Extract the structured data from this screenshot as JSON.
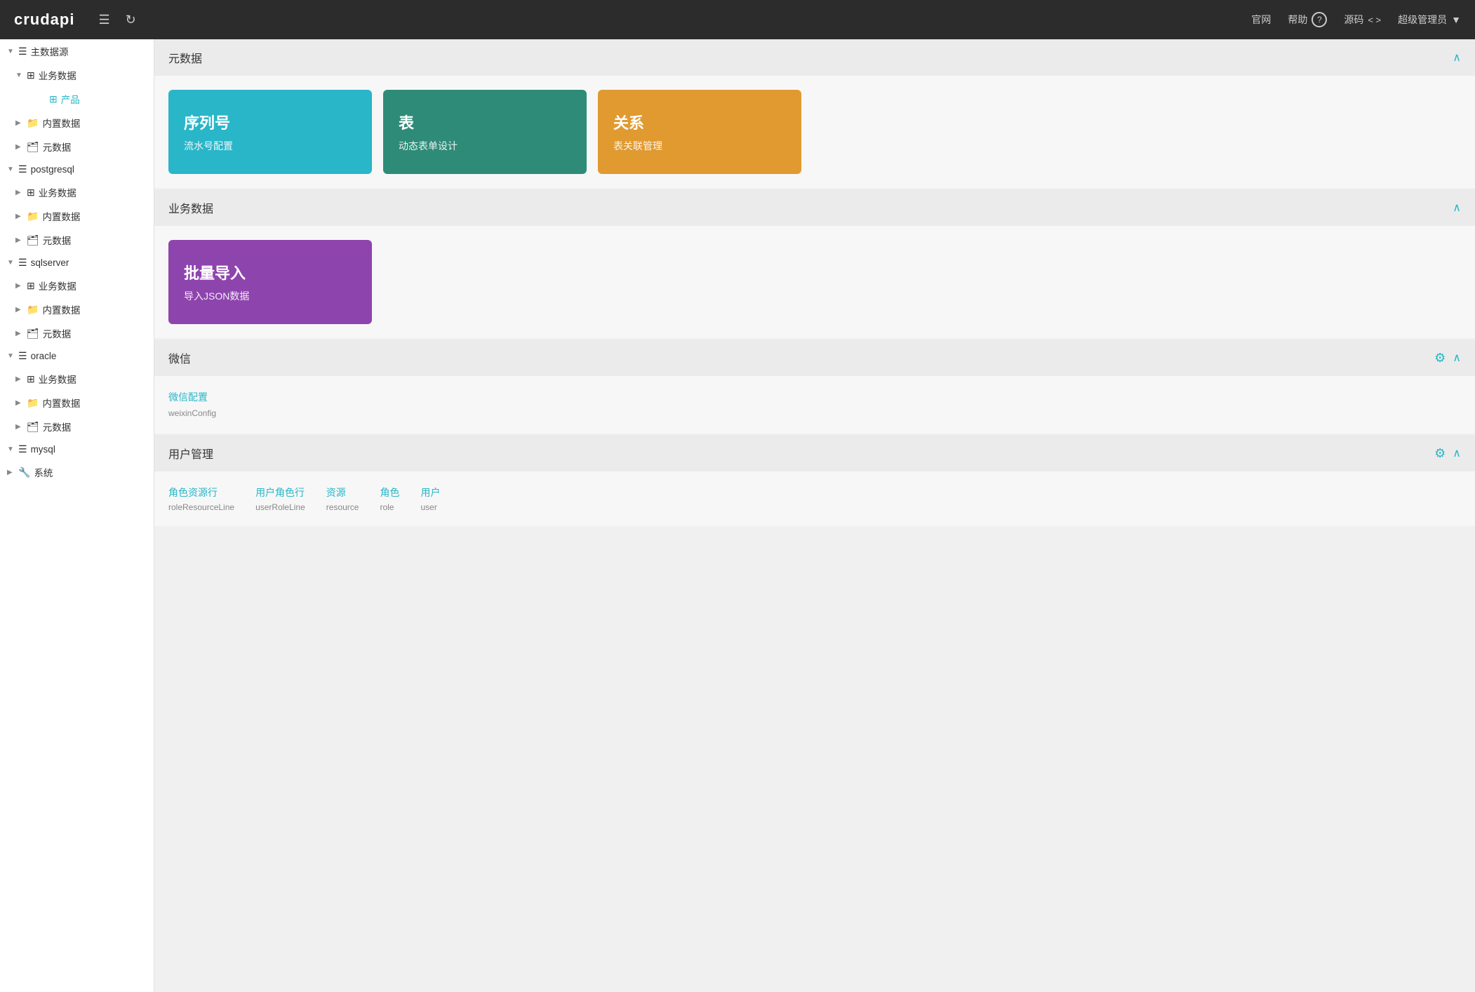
{
  "header": {
    "logo": "crudapi",
    "menu_icon": "☰",
    "refresh_icon": "↻",
    "nav_items": [
      {
        "label": "官网"
      },
      {
        "label": "帮助"
      },
      {
        "label": "源码",
        "extra": "< >"
      },
      {
        "label": "超级管理员",
        "extra": "▼"
      }
    ]
  },
  "sidebar": {
    "items": [
      {
        "indent": 0,
        "arrow": "down",
        "icon": "db",
        "label": "主数据源"
      },
      {
        "indent": 1,
        "arrow": "down",
        "icon": "table",
        "label": "业务数据"
      },
      {
        "indent": 2,
        "arrow": "none",
        "icon": "table-small",
        "label": "产品",
        "active": true
      },
      {
        "indent": 1,
        "arrow": "right",
        "icon": "folder",
        "label": "内置数据"
      },
      {
        "indent": 1,
        "arrow": "right",
        "icon": "briefcase",
        "label": "元数据"
      },
      {
        "indent": 0,
        "arrow": "down",
        "icon": "db",
        "label": "postgresql"
      },
      {
        "indent": 1,
        "arrow": "right",
        "icon": "table",
        "label": "业务数据"
      },
      {
        "indent": 1,
        "arrow": "right",
        "icon": "folder",
        "label": "内置数据"
      },
      {
        "indent": 1,
        "arrow": "right",
        "icon": "briefcase",
        "label": "元数据"
      },
      {
        "indent": 0,
        "arrow": "down",
        "icon": "db",
        "label": "sqlserver"
      },
      {
        "indent": 1,
        "arrow": "right",
        "icon": "table",
        "label": "业务数据"
      },
      {
        "indent": 1,
        "arrow": "right",
        "icon": "folder",
        "label": "内置数据"
      },
      {
        "indent": 1,
        "arrow": "right",
        "icon": "briefcase",
        "label": "元数据"
      },
      {
        "indent": 0,
        "arrow": "down",
        "icon": "db",
        "label": "oracle"
      },
      {
        "indent": 1,
        "arrow": "right",
        "icon": "table",
        "label": "业务数据"
      },
      {
        "indent": 1,
        "arrow": "right",
        "icon": "folder",
        "label": "内置数据"
      },
      {
        "indent": 1,
        "arrow": "right",
        "icon": "briefcase",
        "label": "元数据"
      },
      {
        "indent": 0,
        "arrow": "down",
        "icon": "db",
        "label": "mysql"
      },
      {
        "indent": 0,
        "arrow": "right",
        "icon": "wrench",
        "label": "系统"
      }
    ]
  },
  "main": {
    "sections": [
      {
        "id": "metadata",
        "title": "元数据",
        "show_gear": false,
        "collapsed": false,
        "cards": [
          {
            "color": "cyan",
            "title": "序列号",
            "sub": "流水号配置"
          },
          {
            "color": "teal",
            "title": "表",
            "sub": "动态表单设计"
          },
          {
            "color": "orange",
            "title": "关系",
            "sub": "表关联管理"
          }
        ]
      },
      {
        "id": "business",
        "title": "业务数据",
        "show_gear": false,
        "collapsed": false,
        "cards": [
          {
            "color": "purple",
            "title": "批量导入",
            "sub": "导入JSON数据"
          }
        ]
      },
      {
        "id": "weixin",
        "title": "微信",
        "show_gear": true,
        "collapsed": false,
        "links": [
          {
            "name": "微信配置",
            "sub": "weixinConfig"
          }
        ]
      },
      {
        "id": "user-management",
        "title": "用户管理",
        "show_gear": true,
        "collapsed": false,
        "user_links": [
          {
            "name": "角色资源行",
            "sub": "roleResourceLine"
          },
          {
            "name": "用户角色行",
            "sub": "userRoleLine"
          },
          {
            "name": "资源",
            "sub": "resource"
          },
          {
            "name": "角色",
            "sub": "role"
          },
          {
            "name": "用户",
            "sub": "user"
          }
        ]
      }
    ]
  }
}
